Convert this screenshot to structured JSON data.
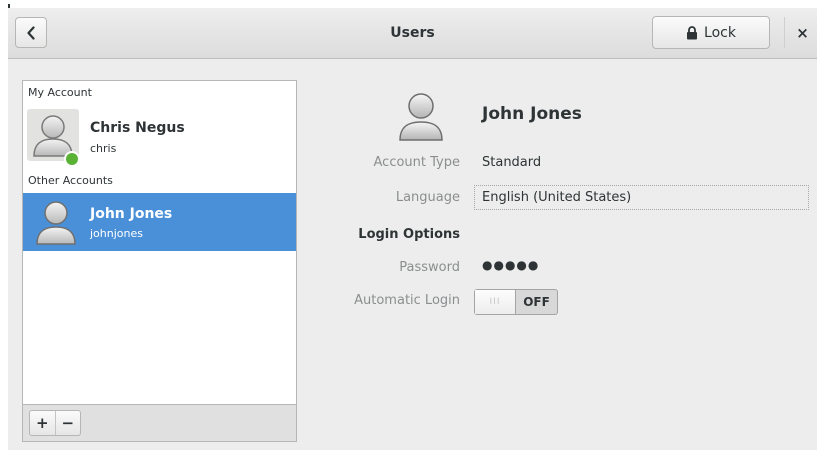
{
  "header": {
    "title": "Users",
    "back_icon": "chevron-left-icon",
    "lock_label": "Lock",
    "lock_icon": "lock-icon",
    "close_glyph": "×"
  },
  "accounts_list": {
    "my_account_label": "My Account",
    "other_accounts_label": "Other Accounts",
    "my_account": {
      "name": "Chris Negus",
      "login": "chris",
      "status": "online"
    },
    "others": [
      {
        "name": "John Jones",
        "login": "johnjones",
        "selected": true
      }
    ],
    "add_label": "+",
    "remove_label": "−"
  },
  "details": {
    "full_name": "John Jones",
    "account_type_label": "Account Type",
    "account_type_value": "Standard",
    "language_label": "Language",
    "language_value": "English (United States)",
    "login_options_label": "Login Options",
    "password_label": "Password",
    "password_value": "●●●●●",
    "automatic_login_label": "Automatic Login",
    "automatic_login_switch_grip": "III",
    "automatic_login_state": "OFF"
  },
  "colors": {
    "selection": "#4a90d9",
    "online_status": "#5ab235",
    "window_bg": "#ededed"
  }
}
